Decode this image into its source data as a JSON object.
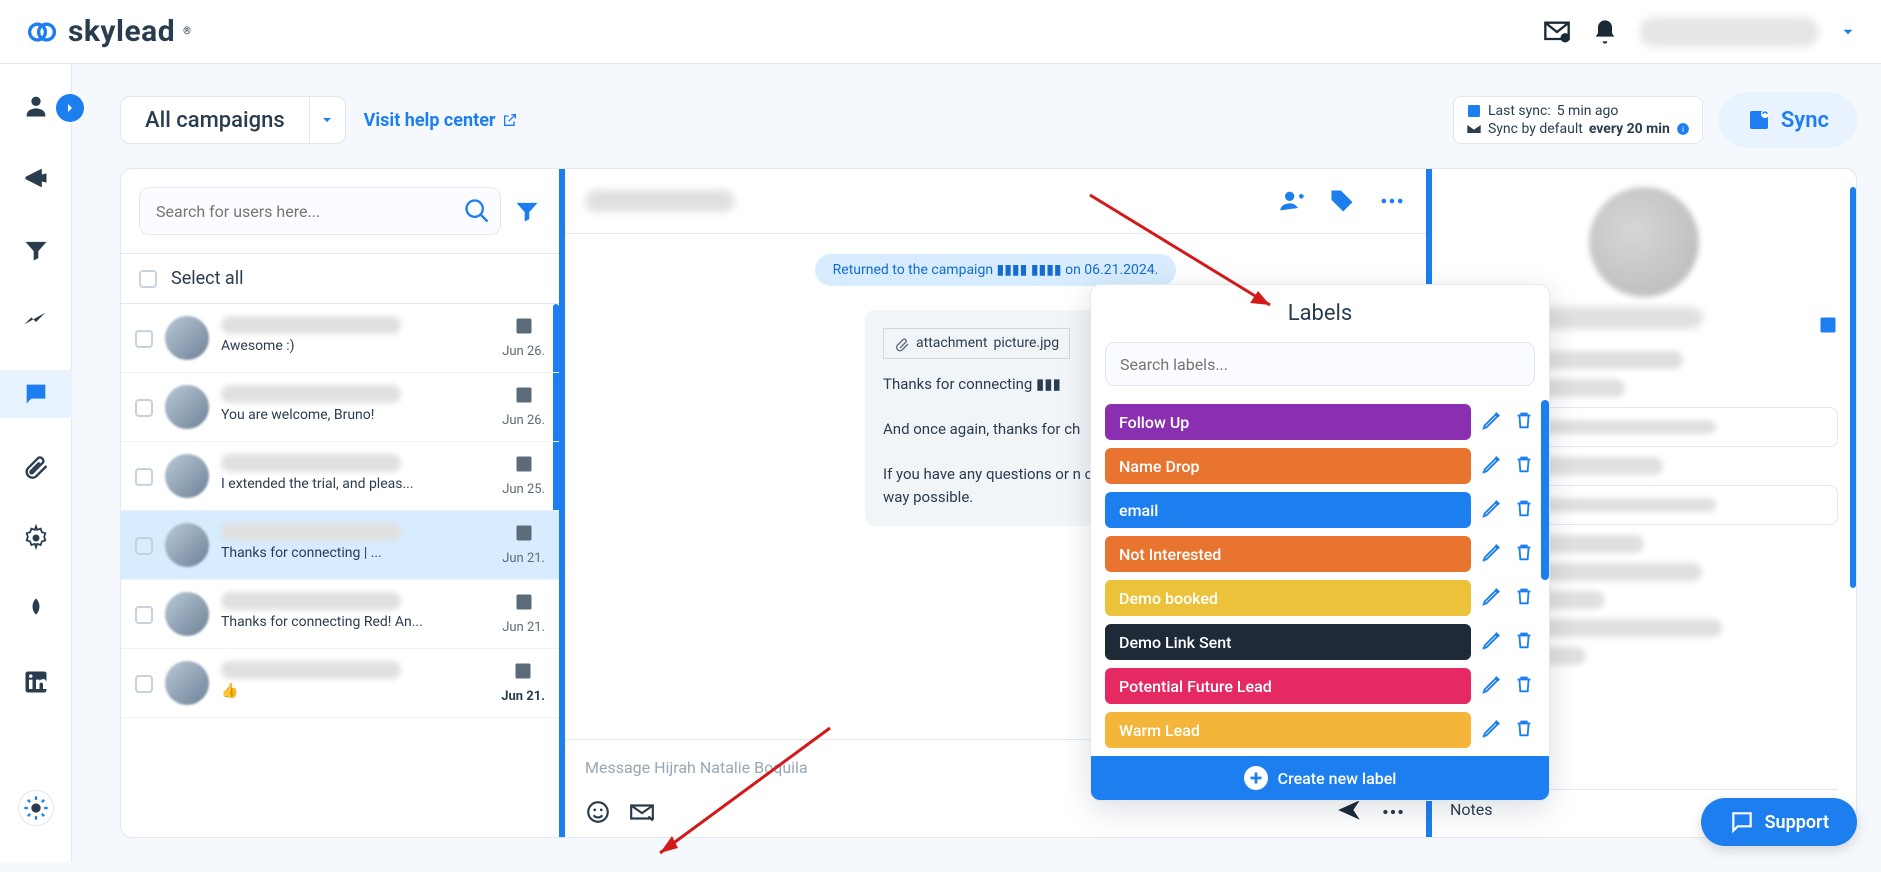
{
  "brand": "skylead",
  "header": {
    "campaigns_label": "All campaigns",
    "help_link": "Visit help center",
    "last_sync_label": "Last sync:",
    "last_sync_value": "5 min ago",
    "sync_default_label": "Sync by default",
    "sync_default_value": "every 20 min",
    "sync_button": "Sync"
  },
  "inbox": {
    "search_placeholder": "Search for users here...",
    "select_all": "Select all",
    "items": [
      {
        "preview": "Awesome :)",
        "date": "Jun 26."
      },
      {
        "preview": "You are welcome, Bruno!",
        "date": "Jun 26."
      },
      {
        "preview": "I extended the trial, and pleas...",
        "date": "Jun 25."
      },
      {
        "preview": "Thanks for connecting      | ...",
        "date": "Jun 21."
      },
      {
        "preview": "Thanks for connecting Red! An...",
        "date": "Jun 21."
      },
      {
        "preview": "👍",
        "date": "Jun 21."
      }
    ]
  },
  "conversation": {
    "system_msg": "Returned to the campaign  ▮▮▮▮  ▮▮▮▮  on 06.21.2024.",
    "attachment": "picture.jpg",
    "attachment_alt": "attachment",
    "body_line1": "Thanks for connecting  ▮▮▮",
    "body_line2": "And once again, thanks for ch",
    "body_line3": "If you have any questions or n                     contact us through the chat. W                     help in any way possible.",
    "input_placeholder": "Message Hijrah Natalie Boquila"
  },
  "profile": {
    "notes_label": "Notes"
  },
  "labels": {
    "title": "Labels",
    "search_placeholder": "Search labels...",
    "create_label": "Create new label",
    "items": [
      {
        "name": "Follow Up",
        "color": "#8a2fb0"
      },
      {
        "name": "Name Drop",
        "color": "#e87430"
      },
      {
        "name": "email",
        "color": "#1d7ef0"
      },
      {
        "name": "Not Interested",
        "color": "#e87430"
      },
      {
        "name": "Demo booked",
        "color": "#ecc23b"
      },
      {
        "name": "Demo Link Sent",
        "color": "#1f2a38"
      },
      {
        "name": "Potential Future Lead",
        "color": "#e52a63"
      },
      {
        "name": "Warm Lead",
        "color": "#f3b63a"
      }
    ]
  },
  "support": "Support"
}
